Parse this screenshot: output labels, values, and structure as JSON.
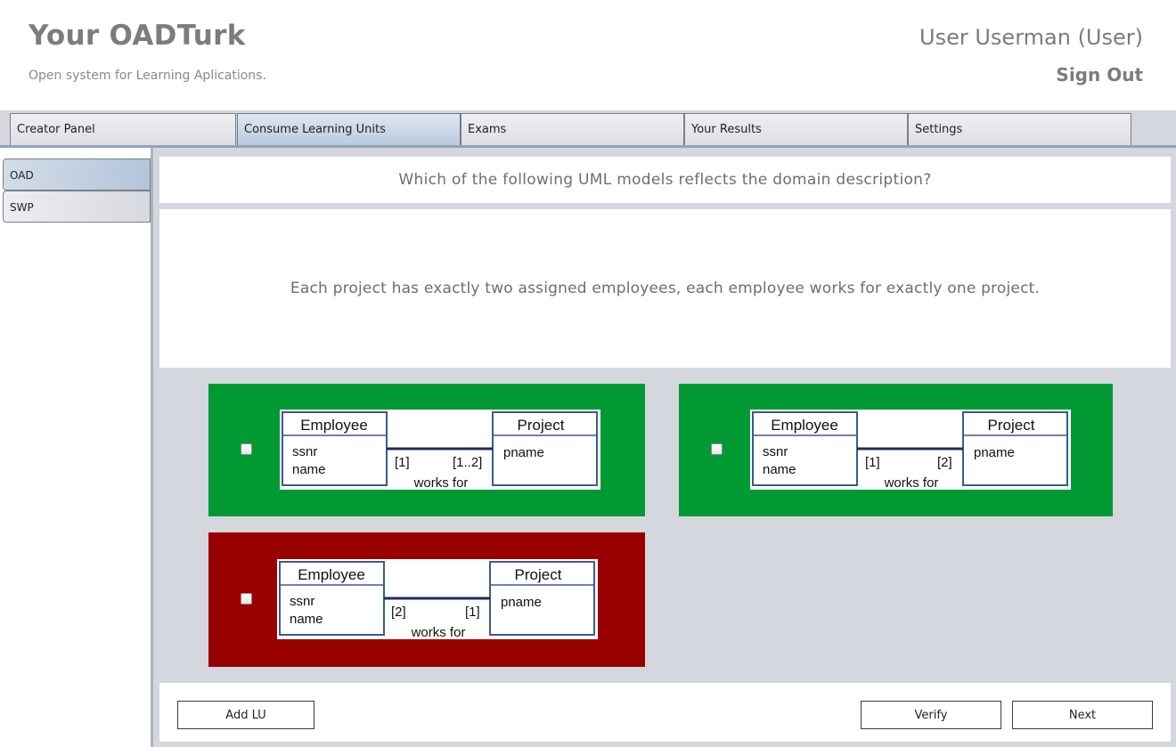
{
  "app": {
    "title": "Your OADTurk",
    "subtitle": "Open system for Learning Aplications.",
    "user": "User Userman (User)",
    "sign_out": "Sign Out"
  },
  "tabs": [
    {
      "label": "Creator Panel",
      "active": false
    },
    {
      "label": "Consume Learning Units",
      "active": true
    },
    {
      "label": "Exams",
      "active": false
    },
    {
      "label": "Your Results",
      "active": false
    },
    {
      "label": "Settings",
      "active": false
    }
  ],
  "sidebar": {
    "items": [
      {
        "label": "OAD",
        "active": true
      },
      {
        "label": "SWP",
        "active": false
      }
    ]
  },
  "question": {
    "prompt": "Which of the following UML models reflects the domain description?",
    "description": "Each project has exactly two assigned employees, each employee works for exactly one project."
  },
  "options": [
    {
      "status_color": "#009933",
      "checked": false,
      "uml": {
        "class_a": "Employee",
        "class_a_attr1": "ssnr",
        "class_a_attr2": "name",
        "class_b": "Project",
        "class_b_attr1": "pname",
        "mult_left": "[1]",
        "mult_right": "[1..2]",
        "association": "works for"
      }
    },
    {
      "status_color": "#009933",
      "checked": false,
      "uml": {
        "class_a": "Employee",
        "class_a_attr1": "ssnr",
        "class_a_attr2": "name",
        "class_b": "Project",
        "class_b_attr1": "pname",
        "mult_left": "[1]",
        "mult_right": "[2]",
        "association": "works for"
      }
    },
    {
      "status_color": "#990000",
      "checked": false,
      "uml": {
        "class_a": "Employee",
        "class_a_attr1": "ssnr",
        "class_a_attr2": "name",
        "class_b": "Project",
        "class_b_attr1": "pname",
        "mult_left": "[2]",
        "mult_right": "[1]",
        "association": "works for"
      }
    }
  ],
  "buttons": {
    "add_lu": "Add LU",
    "verify": "Verify",
    "next": "Next"
  }
}
